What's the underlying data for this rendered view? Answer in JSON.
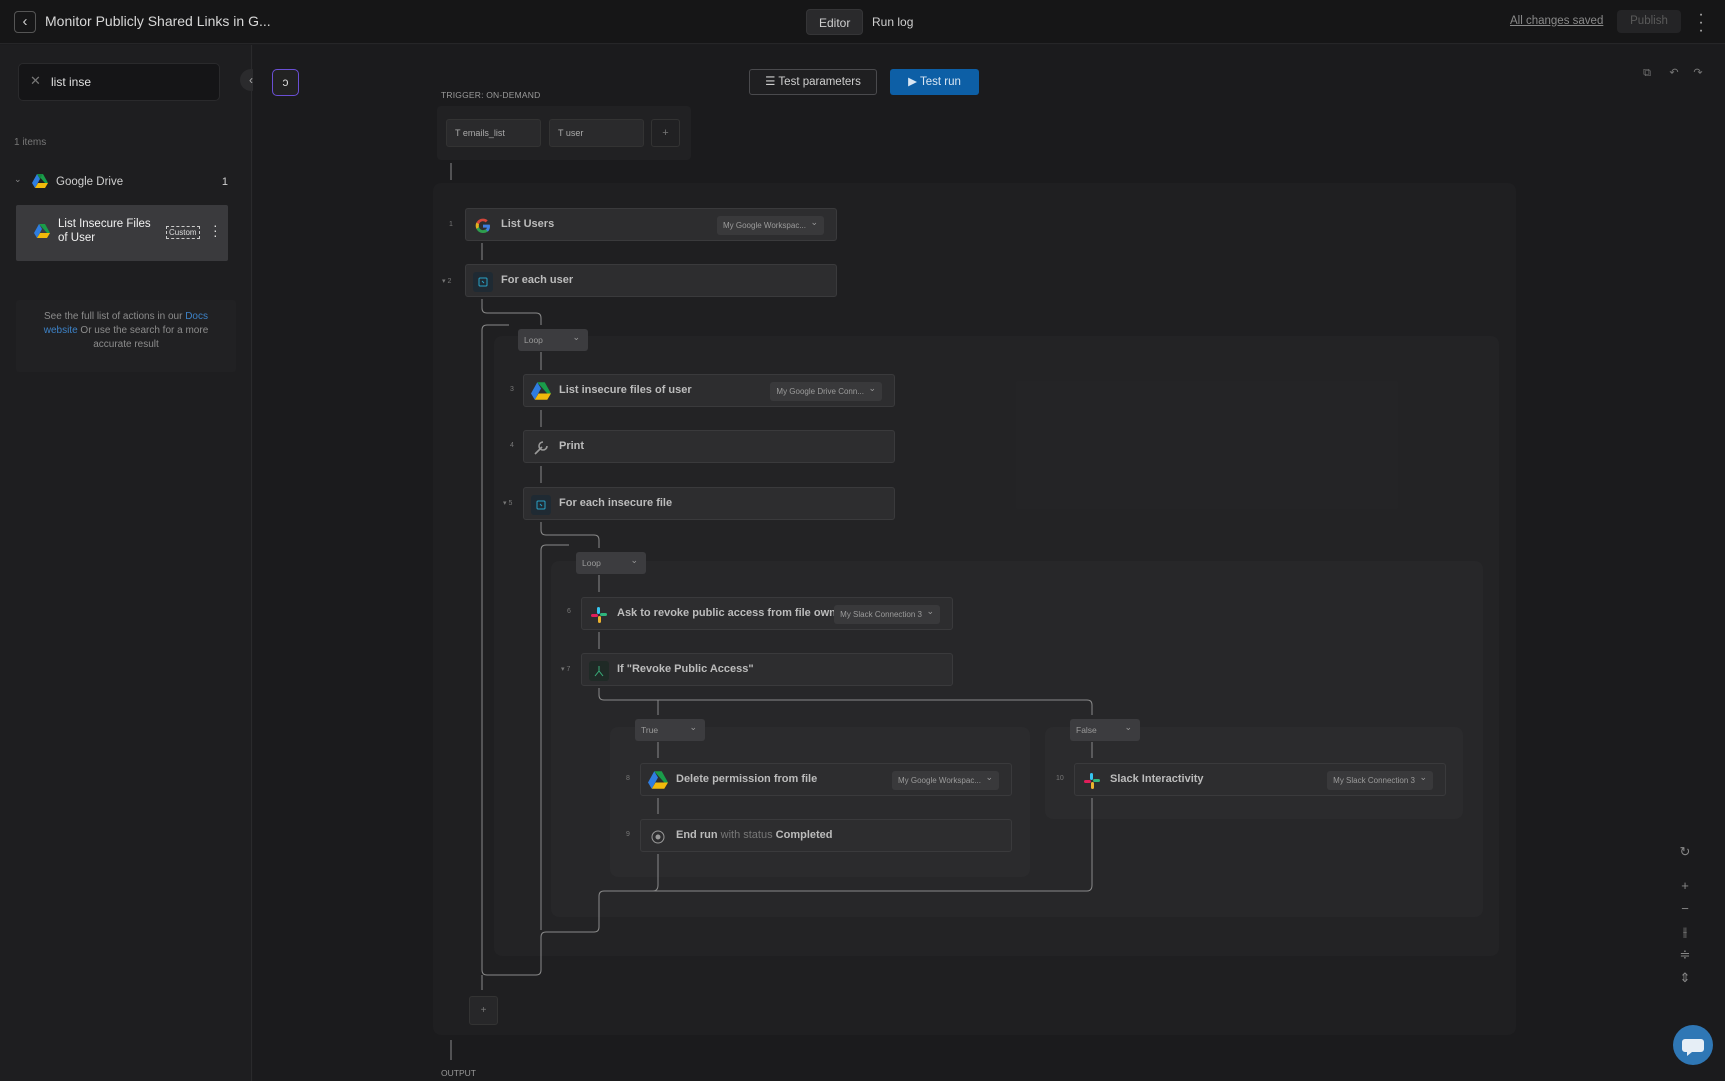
{
  "header": {
    "title": "Monitor Publicly Shared Links in G...",
    "tabs": [
      {
        "label": "Editor",
        "active": true
      },
      {
        "label": "Run log",
        "active": false
      }
    ],
    "save_status": "All changes saved",
    "publish_label": "Publish"
  },
  "sidebar": {
    "search_value": "list inse",
    "items_count": "1 items",
    "group": {
      "name": "Google Drive",
      "count": "1"
    },
    "action": {
      "label": "List Insecure Files of User",
      "badge": "Custom"
    },
    "docs": {
      "pre": "See the full list of actions in our ",
      "link": "Docs website",
      "post": " Or use the search for a more accurate result"
    }
  },
  "toolbar": {
    "test_parameters": "Test parameters",
    "test_run": "Test run"
  },
  "trigger": {
    "label": "TRIGGER: ON-DEMAND",
    "params": [
      "emails_list",
      "user"
    ],
    "add": "+"
  },
  "nodes": [
    {
      "idx": "1",
      "label": "List Users",
      "connection": "My Google Workspac...",
      "icon": "google-icon"
    },
    {
      "idx": "2",
      "label": "For each user",
      "icon": "loop-icon"
    },
    {
      "idx": "3",
      "label": "List insecure files of user",
      "connection": "My Google Drive Conn...",
      "icon": "google-drive-icon"
    },
    {
      "idx": "4",
      "label": "Print",
      "icon": "wrench-icon"
    },
    {
      "idx": "5",
      "label": "For each insecure file",
      "icon": "loop-icon"
    },
    {
      "idx": "6",
      "label": "Ask to revoke public access from file owner",
      "connection": "My Slack Connection 3",
      "icon": "slack-icon"
    },
    {
      "idx": "7",
      "label": "If \"Revoke Public Access\"",
      "icon": "branch-icon"
    },
    {
      "idx": "8",
      "label": "Delete permission from file",
      "connection": "My Google Workspac...",
      "icon": "google-drive-icon"
    },
    {
      "idx": "9",
      "label": "End run",
      "status_kw": "with status",
      "status": "Completed",
      "icon": "stop-icon"
    },
    {
      "idx": "10",
      "label": "Slack Interactivity",
      "connection": "My Slack Connection 3",
      "icon": "slack-icon"
    }
  ],
  "pills": {
    "loop1": "Loop",
    "loop2": "Loop",
    "true": "True",
    "false": "False"
  },
  "output_label": "OUTPUT",
  "add_step": "+"
}
